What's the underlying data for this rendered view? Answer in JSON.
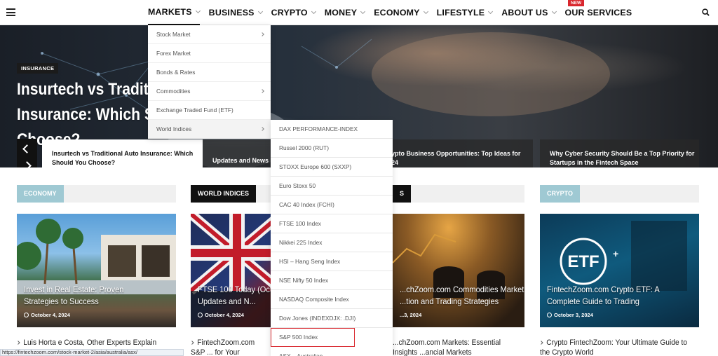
{
  "nav": {
    "items": [
      {
        "label": "MARKETS",
        "active": true
      },
      {
        "label": "BUSINESS"
      },
      {
        "label": "CRYPTO"
      },
      {
        "label": "MONEY"
      },
      {
        "label": "ECONOMY"
      },
      {
        "label": "LIFESTYLE"
      },
      {
        "label": "ABOUT US"
      },
      {
        "label": "OUR SERVICES"
      }
    ],
    "new_badge": "NEW"
  },
  "hero": {
    "tag": "INSURANCE",
    "title": "Insurtech vs Traditional Auto Insurance: Which Should You Choose?",
    "slides": [
      "Insurtech vs Traditional Auto Insurance: Which Should You Choose?",
      "Updates and News",
      "Crypto Business Opportunities: Top Ideas for 2024",
      "Why Cyber Security Should Be a Top Priority for Startups in the Fintech Space"
    ]
  },
  "markets_menu": [
    {
      "label": "Stock Market",
      "has_sub": true
    },
    {
      "label": "Forex Market",
      "has_sub": false
    },
    {
      "label": "Bonds & Rates",
      "has_sub": false
    },
    {
      "label": "Commodities",
      "has_sub": true
    },
    {
      "label": "Exchange Traded Fund (ETF)",
      "has_sub": false
    },
    {
      "label": "World Indices",
      "has_sub": true
    }
  ],
  "world_indices_menu": [
    "DAX PERFORMANCE-INDEX",
    "Russel 2000 (RUT)",
    "STOXX Europe 600 (SXXP)",
    "Euro Stoxx 50",
    "CAC 40 Index (FCHI)",
    "FTSE 100 Index",
    "Nikkei 225 Index",
    "HSI – Hang Seng Index",
    "NSE Nifty 50 Index",
    "NASDAQ Composite Index",
    "Dow Jones (INDEXDJX: .DJI)",
    "S&P 500 Index",
    "ASX – Australian"
  ],
  "sections": [
    {
      "label": "ECONOMY",
      "color": "#9fc9d3",
      "card_title": "Invest in Real Estate: Proven Strategies to Success",
      "date": "October 4, 2024",
      "link": "Luis Horta e Costa, Other Experts Explain Real"
    },
    {
      "label": "WORLD INDICES",
      "color": "#111111",
      "card_title": "FTSE 100 Today (Oct... Market Updates and N...",
      "date": "October 4, 2024",
      "link": "FintechZoom.com S&P ... for Your Investment Po..."
    },
    {
      "label": "S",
      "color": "#111111",
      "card_title": "...chZoom.com Commodities Market: ...tion and Trading Strategies",
      "date": "...3, 2024",
      "link": "...chZoom.com Markets: Essential Insights ...ancial Markets"
    },
    {
      "label": "CRYPTO",
      "color": "#9fc9d3",
      "card_title": "FintechZoom.com Crypto ETF: A Complete Guide to Trading",
      "date": "October 3, 2024",
      "link": "Crypto FintechZoom: Your Ultimate Guide to the Crypto World"
    }
  ],
  "status_url": "https://fintechzoom.com/stock-market-2/asia/australia/asx/"
}
